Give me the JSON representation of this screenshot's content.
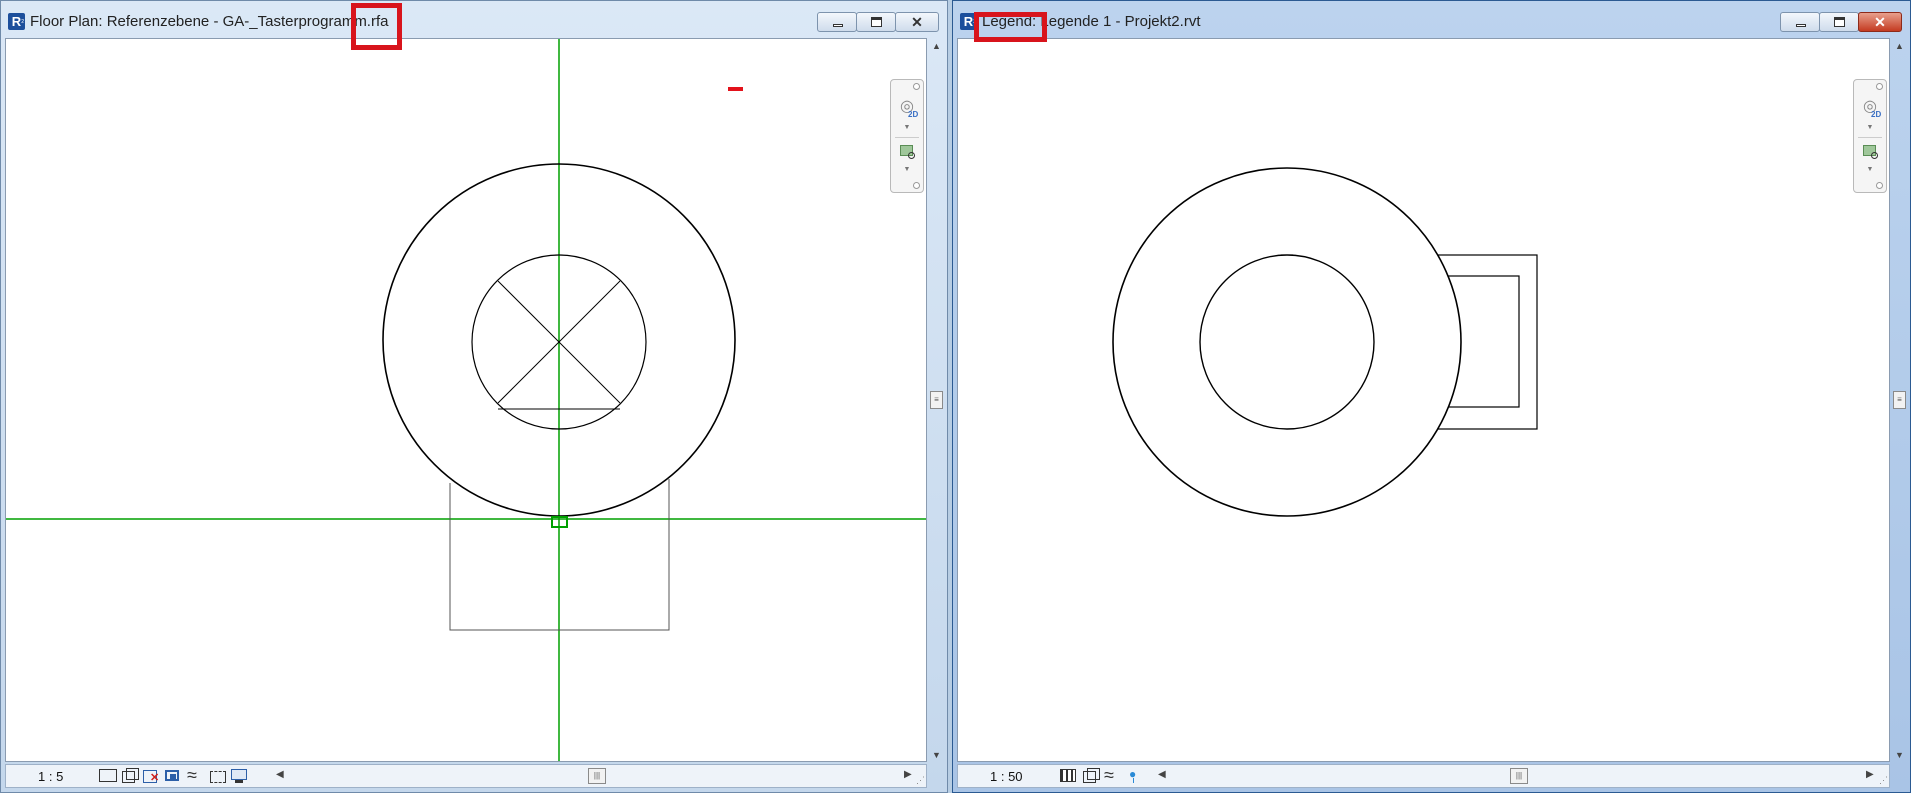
{
  "left_window": {
    "title": "Floor Plan: Referenzebene - GA-_Tasterprogramm.rfa",
    "scale": "1 : 5",
    "view_control_icons": [
      "detail-level-icon",
      "visual-style-icon",
      "sun-path-off-icon",
      "shadows-icon",
      "crop-view-icon",
      "show-crop-region-icon",
      "temporary-hide-icon"
    ],
    "annotation_colors": {
      "reference_plane": "#00a000",
      "highlight": "#d8141c"
    }
  },
  "right_window": {
    "title": "Legend: Legende 1 - Projekt2.rvt",
    "scale": "1 : 50",
    "view_control_icons": [
      "detail-level-icon",
      "visual-style-icon",
      "temporary-hide-icon",
      "reveal-hidden-icon"
    ]
  },
  "nav_bar": {
    "label_2d": "2D"
  },
  "window_controls": {
    "minimize": "minimize-icon",
    "restore": "restore-icon",
    "close": "✕"
  }
}
